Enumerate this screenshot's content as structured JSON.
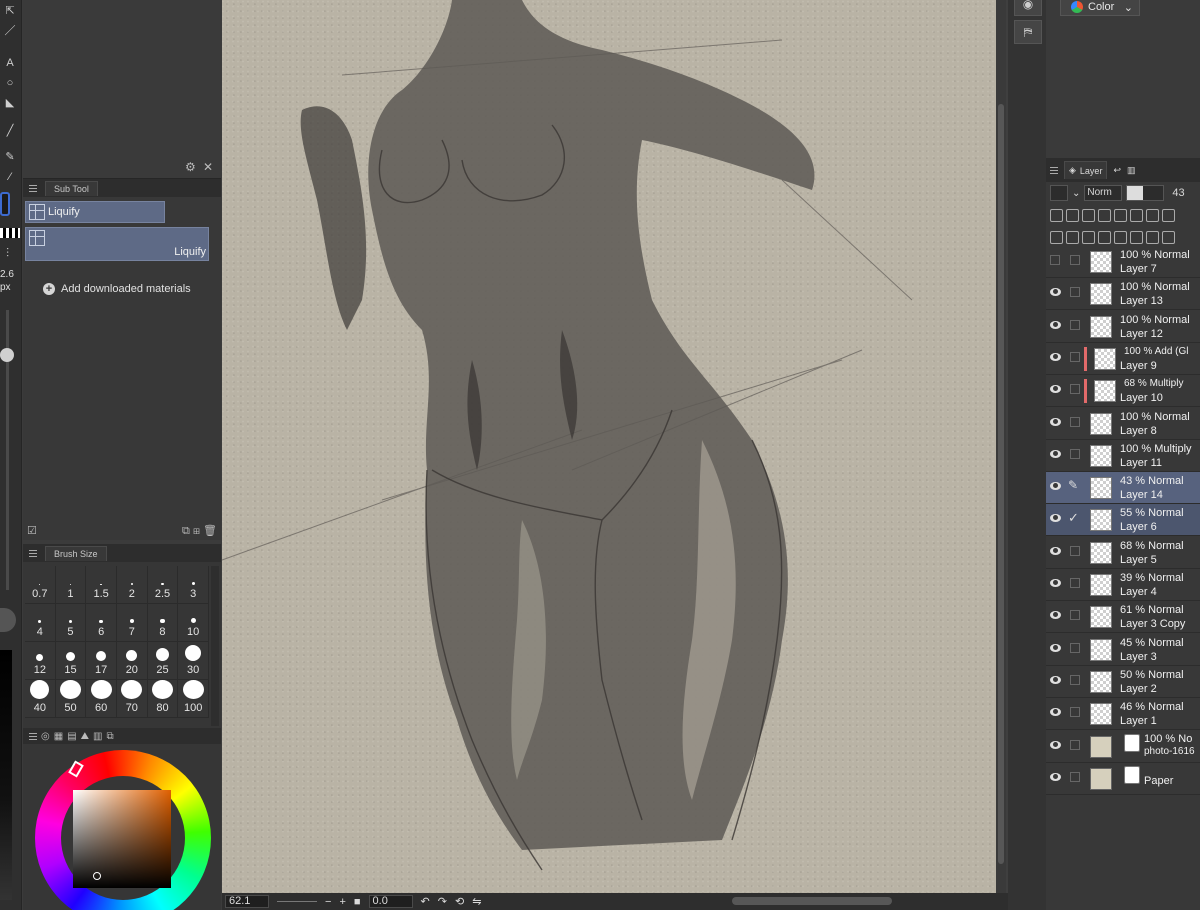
{
  "brush_size_readout": "2.6",
  "brush_size_unit": "px",
  "subtool_panel": {
    "tab_label": "Sub Tool",
    "group_label": "Liquify",
    "item_label": "Liquify",
    "add_materials_label": "Add downloaded materials"
  },
  "brush_size_panel": {
    "tab_label": "Brush Size",
    "sizes": [
      "0.7",
      "1",
      "1.5",
      "2",
      "2.5",
      "3",
      "4",
      "5",
      "6",
      "7",
      "8",
      "10",
      "12",
      "15",
      "17",
      "20",
      "25",
      "30",
      "40",
      "50",
      "60",
      "70",
      "80",
      "100"
    ]
  },
  "status_bar": {
    "zoom": "62.1",
    "rotation": "0.0"
  },
  "navigator": {
    "color_mode": "Color"
  },
  "layer_panel": {
    "tab_label": "Layer",
    "blend_mode": "Norm",
    "opacity": "43",
    "layers": [
      {
        "mode": "100 % Normal",
        "name": "Layer 7",
        "visible": false
      },
      {
        "mode": "100 % Normal",
        "name": "Layer 13",
        "visible": true
      },
      {
        "mode": "100 % Normal",
        "name": "Layer 12",
        "visible": true
      },
      {
        "mode": "100 % Add (Gl",
        "name": "Layer 9",
        "visible": true,
        "clipped": true
      },
      {
        "mode": "68 % Multiply",
        "name": "Layer 10",
        "visible": true,
        "clipped": true
      },
      {
        "mode": "100 % Normal",
        "name": "Layer 8",
        "visible": true
      },
      {
        "mode": "100 % Multiply",
        "name": "Layer 11",
        "visible": true
      },
      {
        "mode": "43 % Normal",
        "name": "Layer 14",
        "visible": true,
        "selected": true
      },
      {
        "mode": "55 % Normal",
        "name": "Layer 6",
        "visible": true,
        "selected": true
      },
      {
        "mode": "68 % Normal",
        "name": "Layer 5",
        "visible": true
      },
      {
        "mode": "39 % Normal",
        "name": "Layer 4",
        "visible": true
      },
      {
        "mode": "61 % Normal",
        "name": "Layer 3 Copy",
        "visible": true
      },
      {
        "mode": "45 % Normal",
        "name": "Layer 3",
        "visible": true
      },
      {
        "mode": "50 % Normal",
        "name": "Layer 2",
        "visible": true
      },
      {
        "mode": "46 % Normal",
        "name": "Layer 1",
        "visible": true
      },
      {
        "mode": "100 % No",
        "name": "photo-1616",
        "visible": true
      },
      {
        "mode": "",
        "name": "Paper",
        "visible": true
      }
    ]
  }
}
